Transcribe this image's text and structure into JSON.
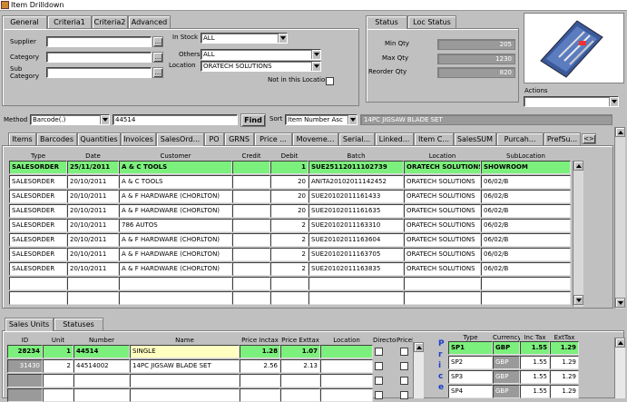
{
  "window": {
    "title": "Item Drilldown"
  },
  "top_tabs": [
    "General",
    "Criteria1",
    "Criteria2",
    "Advanced"
  ],
  "status_tabs": [
    "Status",
    "Loc Status"
  ],
  "general": {
    "supplier_label": "Supplier",
    "category_label": "Category",
    "sub_label": "Sub",
    "sub_label2": "Category",
    "instock_label": "In Stock",
    "instock_value": "ALL",
    "others_label": "Others",
    "others_value": "ALL",
    "location_label": "Location",
    "location_value": "ORATECH SOLUTIONS",
    "not_in_location": "Not in this Location",
    "browse": "..."
  },
  "status": {
    "min_label": "Min Qty",
    "min_value": "205",
    "max_label": "Max Qty",
    "max_value": "1230",
    "reorder_label": "Reorder Qty",
    "reorder_value": "820"
  },
  "actions_label": "Actions",
  "search": {
    "method_label": "Method",
    "method_value": "Barcode(.)",
    "query": "44514",
    "find": "Find",
    "sort_label": "Sort",
    "sort_value": "Item Number Asc",
    "item_desc": "14PC JIGSAW BLADE SET"
  },
  "detail_tabs": [
    "Items",
    "Barcodes",
    "Quantities",
    "Invoices",
    "SalesOrd...",
    "PO",
    "GRNS",
    "Price ...",
    "Moveme...",
    "Serial...",
    "Linked...",
    "Item C...",
    "SalesSUM",
    "Purcah...",
    "PrefSu..."
  ],
  "tab_nav": "<>",
  "orders": {
    "headers": [
      "Type",
      "Date",
      "Customer",
      "Credit",
      "Debit",
      "Batch",
      "Location",
      "SubLocation"
    ],
    "rows": [
      [
        "SALESORDER",
        "25/11/2011",
        "A & C TOOLS",
        "",
        "1",
        "SUE25112011102739",
        "ORATECH SOLUTIONS",
        "SHOWROOM"
      ],
      [
        "SALESORDER",
        "20/10/2011",
        "A & C TOOLS",
        "",
        "20",
        "ANITA20102011142452",
        "ORATECH SOLUTIONS",
        "06/02/B"
      ],
      [
        "SALESORDER",
        "20/10/2011",
        "A & F HARDWARE (CHORLTON)",
        "",
        "20",
        "SUE20102011161433",
        "ORATECH SOLUTIONS",
        "06/02/B"
      ],
      [
        "SALESORDER",
        "20/10/2011",
        "A & F HARDWARE (CHORLTON)",
        "",
        "20",
        "SUE20102011161635",
        "ORATECH SOLUTIONS",
        "06/02/B"
      ],
      [
        "SALESORDER",
        "20/10/2011",
        "786 AUTOS",
        "",
        "2",
        "SUE20102011163310",
        "ORATECH SOLUTIONS",
        "06/02/B"
      ],
      [
        "SALESORDER",
        "20/10/2011",
        "A & F HARDWARE (CHORLTON)",
        "",
        "2",
        "SUE20102011163604",
        "ORATECH SOLUTIONS",
        "06/02/B"
      ],
      [
        "SALESORDER",
        "20/10/2011",
        "A & F HARDWARE (CHORLTON)",
        "",
        "2",
        "SUE20102011163705",
        "ORATECH SOLUTIONS",
        "06/02/B"
      ],
      [
        "SALESORDER",
        "20/10/2011",
        "A & F HARDWARE (CHORLTON)",
        "",
        "2",
        "SUE20102011163835",
        "ORATECH SOLUTIONS",
        "06/02/B"
      ],
      [
        "",
        "",
        "",
        "",
        "",
        "",
        "",
        ""
      ],
      [
        "",
        "",
        "",
        "",
        "",
        "",
        "",
        ""
      ]
    ]
  },
  "bottom_tabs": [
    "Sales Units",
    "Statuses"
  ],
  "units": {
    "headers": [
      "ID",
      "Unit",
      "Number",
      "Name",
      "Price Inctax",
      "Price Exttax",
      "Location",
      "Directory",
      "Pricelist"
    ],
    "rows": [
      [
        "28234",
        "1",
        "44514",
        "SINGLE",
        "1.28",
        "1.07",
        ""
      ],
      [
        "31430",
        "2",
        "44514002",
        "14PC JIGSAW BLADE SET",
        "2.56",
        "2.13",
        ""
      ],
      [
        "",
        "",
        "",
        "",
        "",
        "",
        ""
      ],
      [
        "",
        "",
        "",
        "",
        "",
        "",
        ""
      ]
    ]
  },
  "price": {
    "vertical": [
      "P",
      "r",
      "i",
      "c",
      "e"
    ],
    "headers": [
      "Type",
      "Currency",
      "Inc Tax",
      "ExtTax"
    ],
    "rows": [
      [
        "SP1",
        "GBP",
        "1.55",
        "1.29"
      ],
      [
        "SP2",
        "GBP",
        "1.55",
        "1.29"
      ],
      [
        "SP3",
        "GBP",
        "1.55",
        "1.29"
      ],
      [
        "SP4",
        "GBP",
        "1.55",
        "1.29"
      ]
    ]
  }
}
